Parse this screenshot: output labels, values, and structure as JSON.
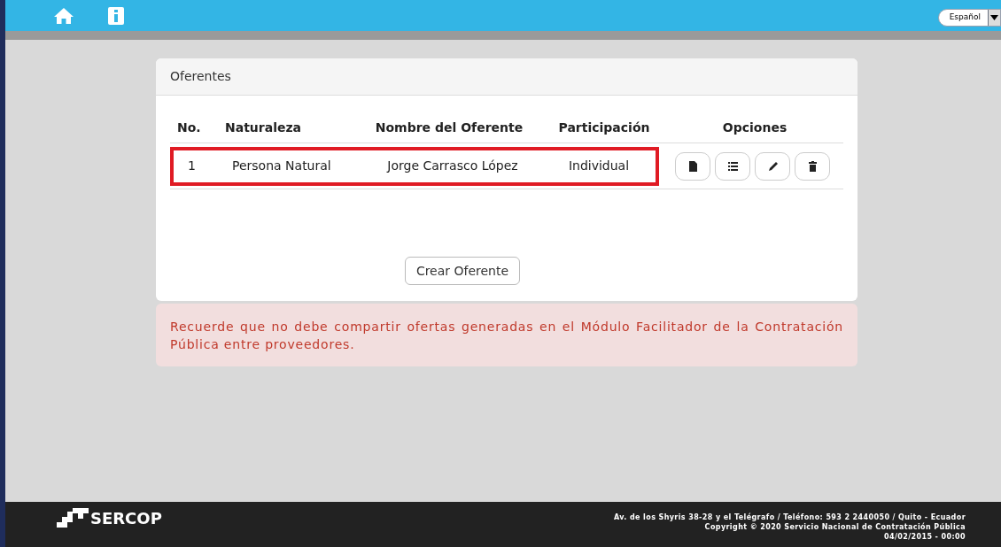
{
  "top_bar": {
    "language": "Español"
  },
  "card": {
    "title": "Oferentes",
    "columns": [
      "No.",
      "Naturaleza",
      "Nombre del Oferente",
      "Participación",
      "Opciones"
    ],
    "rows": [
      {
        "cells": [
          "1",
          "Persona Natural",
          "Jorge Carrasco López",
          "Individual"
        ],
        "highlighted": true
      }
    ],
    "create_button": "Crear Oferente"
  },
  "alert": "Recuerde que no debe compartir ofertas generadas en el Módulo Facilitador de la Contratación Pública entre proveedores.",
  "footer": {
    "logo": "SERCOP",
    "lines": [
      "Av. de los Shyris 38-28 y el Telégrafo / Teléfono: 593 2 2440050 / Quito - Ecuador",
      "Copyright © 2020 Servicio Nacional de Contratación Pública",
      "04/02/2015 - 00:00"
    ]
  }
}
